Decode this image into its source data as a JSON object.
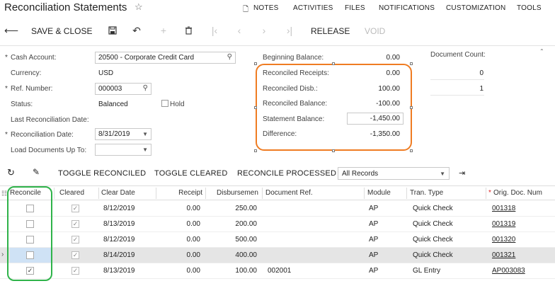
{
  "header": {
    "title": "Reconciliation Statements",
    "nav": [
      "NOTES",
      "ACTIVITIES",
      "FILES",
      "NOTIFICATIONS",
      "CUSTOMIZATION",
      "TOOLS"
    ]
  },
  "toolbar": {
    "save_close": "SAVE & CLOSE",
    "release": "RELEASE",
    "void": "VOID"
  },
  "form": {
    "cash_account_label": "Cash Account:",
    "cash_account_value": "20500 - Corporate Credit Card",
    "currency_label": "Currency:",
    "currency_value": "USD",
    "ref_number_label": "Ref. Number:",
    "ref_number_value": "000003",
    "status_label": "Status:",
    "status_value": "Balanced",
    "hold_label": "Hold",
    "last_recon_date_label": "Last Reconciliation Date:",
    "recon_date_label": "Reconciliation Date:",
    "recon_date_value": "8/31/2019",
    "load_docs_label": "Load Documents Up To:",
    "load_docs_value": ""
  },
  "summary": {
    "beginning_balance_label": "Beginning Balance:",
    "beginning_balance": "0.00",
    "reconciled_receipts_label": "Reconciled Receipts:",
    "reconciled_receipts": "0.00",
    "reconciled_disb_label": "Reconciled Disb.:",
    "reconciled_disb": "100.00",
    "reconciled_balance_label": "Reconciled Balance:",
    "reconciled_balance": "-100.00",
    "statement_balance_label": "Statement Balance:",
    "statement_balance": "-1,450.00",
    "difference_label": "Difference:",
    "difference": "-1,350.00",
    "document_count_label": "Document Count:",
    "count_receipts": "0",
    "count_disb": "1"
  },
  "grid_toolbar": {
    "toggle_reconciled": "TOGGLE RECONCILED",
    "toggle_cleared": "TOGGLE CLEARED",
    "reconcile_processed": "RECONCILE PROCESSED",
    "filter_value": "All Records"
  },
  "grid": {
    "columns": [
      "Reconcile",
      "Cleared",
      "Clear Date",
      "Receipt",
      "Disbursemen",
      "Document Ref.",
      "Module",
      "Tran. Type",
      "Orig. Doc. Num"
    ],
    "rows": [
      {
        "reconcile": false,
        "cleared": true,
        "clear_date": "8/12/2019",
        "receipt": "0.00",
        "disb": "250.00",
        "doc_ref": "",
        "module": "AP",
        "tran_type": "Quick Check",
        "orig_doc": "001318"
      },
      {
        "reconcile": false,
        "cleared": true,
        "clear_date": "8/13/2019",
        "receipt": "0.00",
        "disb": "200.00",
        "doc_ref": "",
        "module": "AP",
        "tran_type": "Quick Check",
        "orig_doc": "001319"
      },
      {
        "reconcile": false,
        "cleared": true,
        "clear_date": "8/12/2019",
        "receipt": "0.00",
        "disb": "500.00",
        "doc_ref": "",
        "module": "AP",
        "tran_type": "Quick Check",
        "orig_doc": "001320"
      },
      {
        "reconcile": false,
        "cleared": true,
        "clear_date": "8/14/2019",
        "receipt": "0.00",
        "disb": "400.00",
        "doc_ref": "",
        "module": "AP",
        "tran_type": "Quick Check",
        "orig_doc": "001321"
      },
      {
        "reconcile": true,
        "cleared": true,
        "clear_date": "8/13/2019",
        "receipt": "0.00",
        "disb": "100.00",
        "doc_ref": "002001",
        "module": "AP",
        "tran_type": "GL Entry",
        "orig_doc": "AP003083"
      }
    ]
  },
  "colors": {
    "highlight_orange": "#ef7c22",
    "highlight_green": "#2fb34a",
    "link": "#1a5fb4"
  }
}
